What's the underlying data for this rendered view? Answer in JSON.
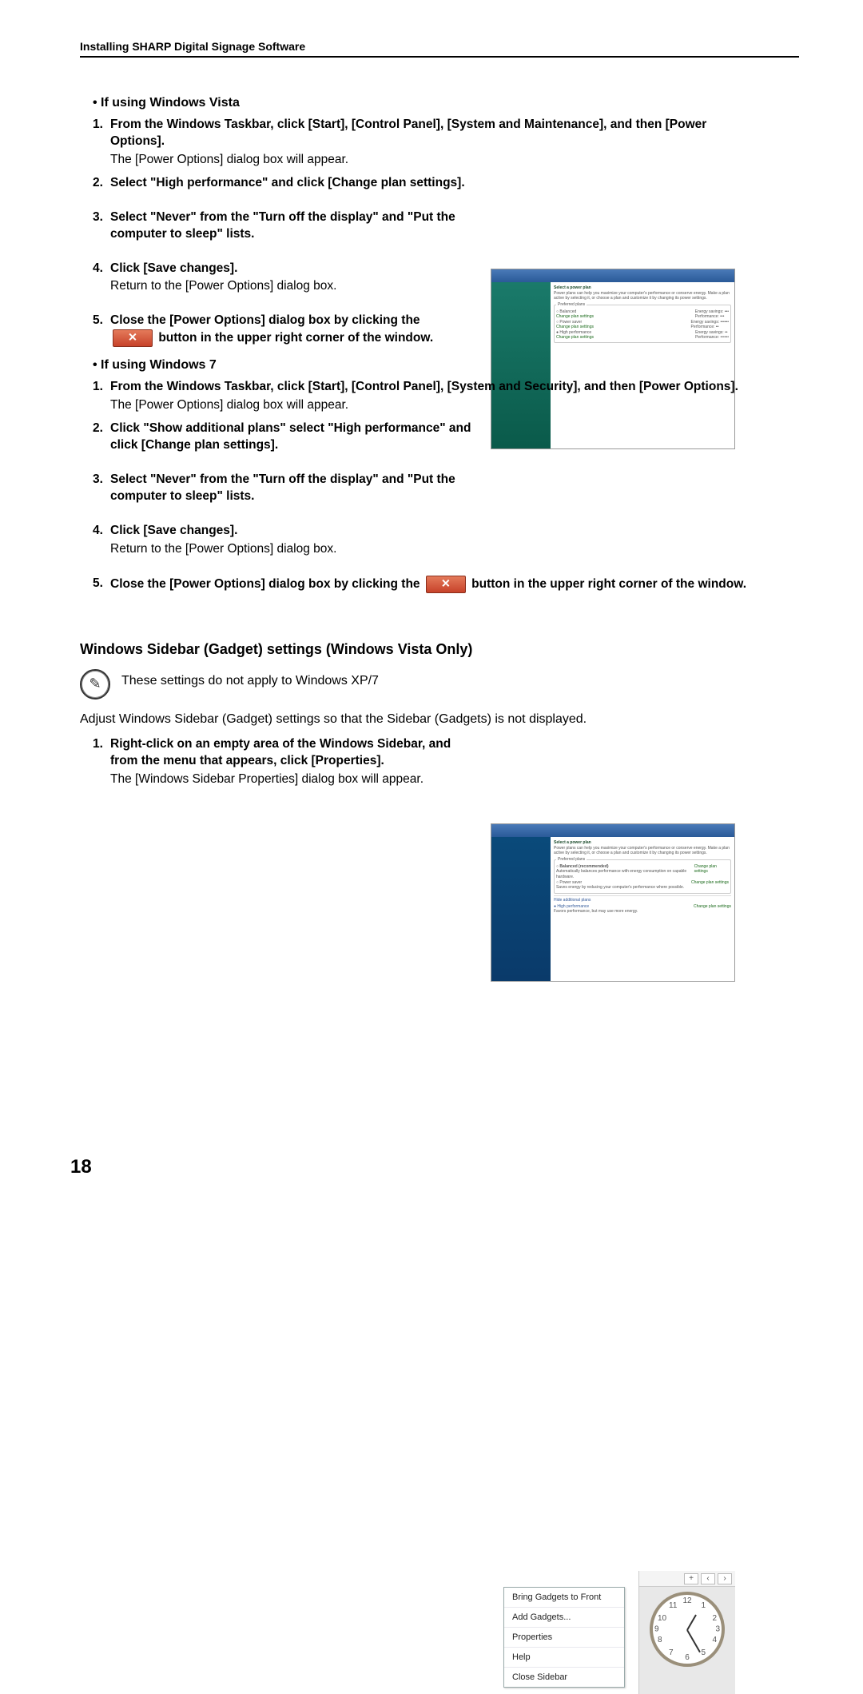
{
  "header": "Installing SHARP Digital Signage Software",
  "page_number": "18",
  "vista_heading": "If using Windows Vista",
  "win7_heading": "If using Windows 7",
  "vista_steps": [
    {
      "n": "1.",
      "bold": "From the Windows Taskbar, click [Start], [Control Panel], [System and Maintenance], and then [Power Options].",
      "plain": "The [Power Options] dialog box will appear."
    },
    {
      "n": "2.",
      "bold": "Select \"High performance\" and click [Change plan settings].",
      "plain": ""
    },
    {
      "n": "3.",
      "bold": "Select \"Never\" from the \"Turn off the display\" and \"Put the computer to sleep\" lists.",
      "plain": ""
    },
    {
      "n": "4.",
      "bold": "Click [Save changes].",
      "plain": "Return to the [Power Options] dialog box."
    },
    {
      "n": "5.",
      "bold_before": "Close the [Power Options] dialog box by clicking the",
      "bold_after": "button in the upper right corner of the window.",
      "close_btn": true
    }
  ],
  "win7_steps": [
    {
      "n": "1.",
      "bold": "From the Windows Taskbar, click [Start], [Control Panel], [System and Security], and then [Power Options].",
      "plain": "The [Power Options] dialog box will appear."
    },
    {
      "n": "2.",
      "bold": "Click \"Show additional plans\" select \"High performance\" and click [Change plan settings].",
      "plain": ""
    },
    {
      "n": "3.",
      "bold": "Select \"Never\" from the \"Turn off the display\" and \"Put the computer to sleep\" lists.",
      "plain": ""
    },
    {
      "n": "4.",
      "bold": "Click [Save changes].",
      "plain": "Return to the [Power Options] dialog box."
    },
    {
      "n": "5.",
      "bold_before": "Close the [Power Options] dialog box by clicking the",
      "bold_after": "button in the upper right corner of the window.",
      "close_btn": true
    }
  ],
  "sidebar_section_title": "Windows Sidebar (Gadget) settings (Windows Vista Only)",
  "sidebar_note": "These settings do not apply to Windows XP/7",
  "sidebar_body": "Adjust Windows Sidebar (Gadget) settings so that the Sidebar (Gadgets) is not displayed.",
  "sidebar_steps": [
    {
      "n": "1.",
      "bold": "Right-click on an empty area of the Windows Sidebar, and from the menu that appears, click [Properties].",
      "plain": "The [Windows Sidebar Properties] dialog box will appear."
    }
  ],
  "context_menu": [
    "Bring Gadgets to Front",
    "Add Gadgets...",
    "Properties",
    "Help",
    "Close Sidebar"
  ],
  "fig_vista": {
    "title": "Select a power plan",
    "desc": "Power plans can help you maximize your computer's performance or conserve energy. Make a plan active by selecting it, or choose a plan and customize it by changing its power settings.",
    "group": "Preferred plans",
    "plans": [
      {
        "name": "Balanced",
        "link": "Change plan settings",
        "es": "Energy savings: •••",
        "pf": "Performance: •••"
      },
      {
        "name": "Power saver",
        "link": "Change plan settings",
        "es": "Energy savings: ••••••",
        "pf": "Performance: ••"
      },
      {
        "name": "High performance",
        "link": "Change plan settings",
        "es": "Energy savings: ••",
        "pf": "Performance: ••••••"
      }
    ]
  },
  "fig_w7": {
    "title": "Select a power plan",
    "desc": "Power plans can help you maximize your computer's performance or conserve energy. Make a plan active by selecting it, or choose a plan and customize it by changing its power settings.",
    "group": "Preferred plans",
    "plans": [
      {
        "name": "Balanced (recommended)",
        "sub": "Automatically balances performance with energy consumption on capable hardware.",
        "link": "Change plan settings"
      },
      {
        "name": "Power saver",
        "sub": "Saves energy by reducing your computer's performance where possible.",
        "link": "Change plan settings"
      }
    ],
    "hide": "Hide additional plans",
    "hp": {
      "name": "High performance",
      "sub": "Favors performance, but may use more energy.",
      "link": "Change plan settings"
    }
  }
}
